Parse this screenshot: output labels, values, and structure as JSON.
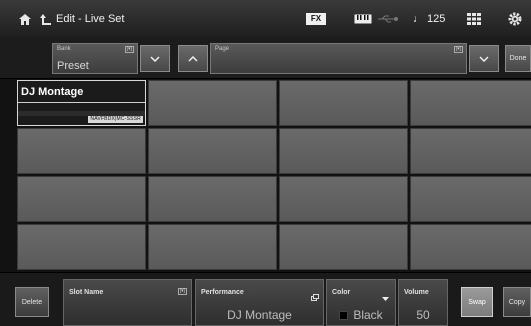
{
  "topbar": {
    "title": "Edit - Live Set",
    "fx_label": "FX",
    "tempo": "♩ 125"
  },
  "bank_row": {
    "bank_label": "Bank",
    "bank_value": "Preset",
    "page_label": "Page",
    "page_value": "",
    "done_label": "Done",
    "filter_tag": "[▾]"
  },
  "grid": {
    "active_slot": {
      "name": "DJ Montage",
      "categories": "NAVFBDX|MC-SSSR"
    }
  },
  "bottom": {
    "delete_label": "Delete",
    "slot_name_label": "Slot Name",
    "slot_name_value": "",
    "performance_label": "Performance",
    "performance_value": "DJ Montage",
    "color_label": "Color",
    "color_value": "Black",
    "volume_label": "Volume",
    "volume_value": "50",
    "swap_label": "Swap",
    "copy_label": "Copy"
  },
  "colors": {
    "background": "#121212",
    "cell": "#626262",
    "active_cell": "#1b1b1b",
    "color_swatch": "#000000"
  }
}
